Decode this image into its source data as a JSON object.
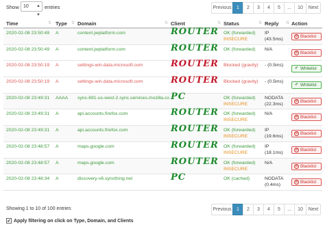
{
  "controls": {
    "show_label": "Show",
    "entries_value": "10",
    "entries_label": "entries"
  },
  "pagination": {
    "prev": "Previous",
    "pages_top": [
      "1",
      "2",
      "3",
      "4",
      "5",
      "...",
      "10"
    ],
    "pages_bottom": [
      "1",
      "2",
      "3",
      "4",
      "5",
      "...",
      "10"
    ],
    "next": "Next",
    "active_page": "1"
  },
  "table": {
    "headers": [
      "Time",
      "Type",
      "Domain",
      "Client",
      "Status",
      "Reply",
      "Action"
    ],
    "rows": [
      {
        "time": "2020-02-08 23:50:49",
        "type": "A",
        "domain": "content.jwplatform.com",
        "client": "ROUTER",
        "status": "OK (forwarded)",
        "status2": "INSECURE",
        "reply": "IP",
        "reply2": "(43.5ms)",
        "action": "Blacklist",
        "blocked": false
      },
      {
        "time": "2020-02-08 23:50:49",
        "type": "A",
        "domain": "content.jwplatform.com",
        "client": "ROUTER",
        "status": "OK (forwarded)",
        "status2": "",
        "reply": "N/A",
        "reply2": "",
        "action": "Blacklist",
        "blocked": false
      },
      {
        "time": "2020-02-08 23:50:19",
        "type": "A",
        "domain": "settings-win.data.microsoft.com",
        "client": "ROUTER",
        "status": "Blocked (gravity)",
        "status2": "",
        "reply": "- (0.5ms)",
        "reply2": "",
        "action": "Whitelist",
        "blocked": true
      },
      {
        "time": "2020-02-08 23:50:19",
        "type": "A",
        "domain": "settings-win.data.microsoft.com",
        "client": "ROUTER",
        "status": "Blocked (gravity)",
        "status2": "",
        "reply": "- (0.5ms)",
        "reply2": "",
        "action": "Whitelist",
        "blocked": true
      },
      {
        "time": "2020-02-08 23:49:31",
        "type": "AAAA",
        "domain": "sync-691-us-west-2.sync.services.mozilla.com",
        "client": "PC",
        "status": "OK (forwarded)",
        "status2": "INSECURE",
        "reply": "NODATA",
        "reply2": "(22.3ms)",
        "action": "Blacklist",
        "blocked": false
      },
      {
        "time": "2020-02-08 23:49:31",
        "type": "A",
        "domain": "api.accounts.firefox.com",
        "client": "ROUTER",
        "status": "OK (forwarded)",
        "status2": "INSECURE",
        "reply": "N/A",
        "reply2": "",
        "action": "Blacklist",
        "blocked": false
      },
      {
        "time": "2020-02-08 23:49:31",
        "type": "A",
        "domain": "api.accounts.firefox.com",
        "client": "ROUTER",
        "status": "OK (forwarded)",
        "status2": "INSECURE",
        "reply": "IP",
        "reply2": "(19.6ms)",
        "action": "Blacklist",
        "blocked": false
      },
      {
        "time": "2020-02-08 23:48:57",
        "type": "A",
        "domain": "maps.google.com",
        "client": "ROUTER",
        "status": "OK (forwarded)",
        "status2": "INSECURE",
        "reply": "IP",
        "reply2": "(18.1ms)",
        "action": "Blacklist",
        "blocked": false
      },
      {
        "time": "2020-02-08 23:48:57",
        "type": "A",
        "domain": "maps.google.com",
        "client": "ROUTER",
        "status": "OK (forwarded)",
        "status2": "INSECURE",
        "reply": "N/A",
        "reply2": "",
        "action": "Blacklist",
        "blocked": false
      },
      {
        "time": "2020-02-08 23:48:34",
        "type": "A",
        "domain": "discovery-v6.syncthing.net",
        "client": "PC",
        "status": "OK (cached)",
        "status2": "",
        "reply": "NODATA",
        "reply2": "(0.4ms)",
        "action": "Blacklist",
        "blocked": false
      }
    ]
  },
  "footer": {
    "info": "Showing 1 to 10 of 100 entries",
    "apply_label": "Apply filtering on click on Type, Domain, and Clients",
    "apply_checked": true
  },
  "colors": {
    "ok_time": "#3a9a3a",
    "blocked_time": "#d9534f",
    "insecure": "#e58e1a",
    "accent": "#3c8dbc",
    "client_router": "#1c8a2c",
    "client_blocked": "#c2182a"
  }
}
